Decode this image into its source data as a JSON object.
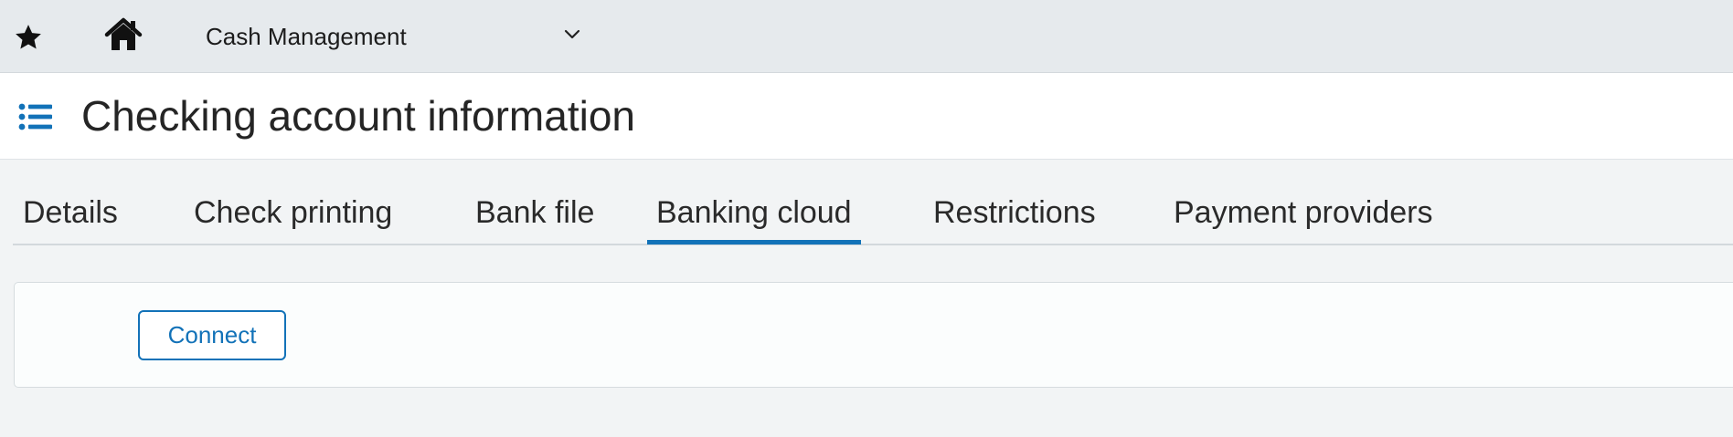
{
  "topbar": {
    "favorite_icon": "star-icon",
    "home_icon": "home-icon",
    "module_label": "Cash Management",
    "module_dropdown_icon": "chevron-down-icon"
  },
  "header": {
    "menu_icon": "list-icon",
    "title": "Checking account information"
  },
  "tabs": [
    {
      "label": "Details",
      "active": false
    },
    {
      "label": "Check printing",
      "active": false
    },
    {
      "label": "Bank file",
      "active": false
    },
    {
      "label": "Banking cloud",
      "active": true
    },
    {
      "label": "Restrictions",
      "active": false
    },
    {
      "label": "Payment providers",
      "active": false
    }
  ],
  "panel": {
    "connect_label": "Connect"
  },
  "colors": {
    "accent": "#1272b8",
    "topbar_bg": "#e6eaed",
    "page_bg": "#f2f4f5",
    "text": "#252525"
  }
}
